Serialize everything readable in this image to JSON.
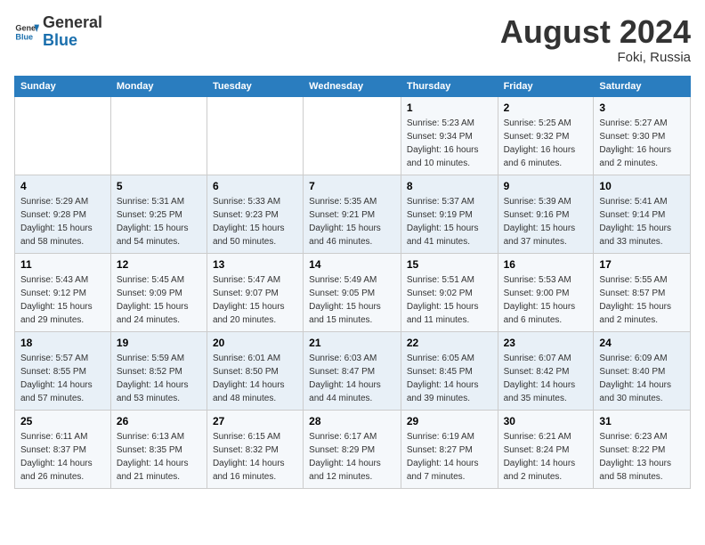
{
  "header": {
    "logo_general": "General",
    "logo_blue": "Blue",
    "month_year": "August 2024",
    "location": "Foki, Russia"
  },
  "days_of_week": [
    "Sunday",
    "Monday",
    "Tuesday",
    "Wednesday",
    "Thursday",
    "Friday",
    "Saturday"
  ],
  "weeks": [
    [
      {
        "day": "",
        "info": ""
      },
      {
        "day": "",
        "info": ""
      },
      {
        "day": "",
        "info": ""
      },
      {
        "day": "",
        "info": ""
      },
      {
        "day": "1",
        "info": "Sunrise: 5:23 AM\nSunset: 9:34 PM\nDaylight: 16 hours\nand 10 minutes."
      },
      {
        "day": "2",
        "info": "Sunrise: 5:25 AM\nSunset: 9:32 PM\nDaylight: 16 hours\nand 6 minutes."
      },
      {
        "day": "3",
        "info": "Sunrise: 5:27 AM\nSunset: 9:30 PM\nDaylight: 16 hours\nand 2 minutes."
      }
    ],
    [
      {
        "day": "4",
        "info": "Sunrise: 5:29 AM\nSunset: 9:28 PM\nDaylight: 15 hours\nand 58 minutes."
      },
      {
        "day": "5",
        "info": "Sunrise: 5:31 AM\nSunset: 9:25 PM\nDaylight: 15 hours\nand 54 minutes."
      },
      {
        "day": "6",
        "info": "Sunrise: 5:33 AM\nSunset: 9:23 PM\nDaylight: 15 hours\nand 50 minutes."
      },
      {
        "day": "7",
        "info": "Sunrise: 5:35 AM\nSunset: 9:21 PM\nDaylight: 15 hours\nand 46 minutes."
      },
      {
        "day": "8",
        "info": "Sunrise: 5:37 AM\nSunset: 9:19 PM\nDaylight: 15 hours\nand 41 minutes."
      },
      {
        "day": "9",
        "info": "Sunrise: 5:39 AM\nSunset: 9:16 PM\nDaylight: 15 hours\nand 37 minutes."
      },
      {
        "day": "10",
        "info": "Sunrise: 5:41 AM\nSunset: 9:14 PM\nDaylight: 15 hours\nand 33 minutes."
      }
    ],
    [
      {
        "day": "11",
        "info": "Sunrise: 5:43 AM\nSunset: 9:12 PM\nDaylight: 15 hours\nand 29 minutes."
      },
      {
        "day": "12",
        "info": "Sunrise: 5:45 AM\nSunset: 9:09 PM\nDaylight: 15 hours\nand 24 minutes."
      },
      {
        "day": "13",
        "info": "Sunrise: 5:47 AM\nSunset: 9:07 PM\nDaylight: 15 hours\nand 20 minutes."
      },
      {
        "day": "14",
        "info": "Sunrise: 5:49 AM\nSunset: 9:05 PM\nDaylight: 15 hours\nand 15 minutes."
      },
      {
        "day": "15",
        "info": "Sunrise: 5:51 AM\nSunset: 9:02 PM\nDaylight: 15 hours\nand 11 minutes."
      },
      {
        "day": "16",
        "info": "Sunrise: 5:53 AM\nSunset: 9:00 PM\nDaylight: 15 hours\nand 6 minutes."
      },
      {
        "day": "17",
        "info": "Sunrise: 5:55 AM\nSunset: 8:57 PM\nDaylight: 15 hours\nand 2 minutes."
      }
    ],
    [
      {
        "day": "18",
        "info": "Sunrise: 5:57 AM\nSunset: 8:55 PM\nDaylight: 14 hours\nand 57 minutes."
      },
      {
        "day": "19",
        "info": "Sunrise: 5:59 AM\nSunset: 8:52 PM\nDaylight: 14 hours\nand 53 minutes."
      },
      {
        "day": "20",
        "info": "Sunrise: 6:01 AM\nSunset: 8:50 PM\nDaylight: 14 hours\nand 48 minutes."
      },
      {
        "day": "21",
        "info": "Sunrise: 6:03 AM\nSunset: 8:47 PM\nDaylight: 14 hours\nand 44 minutes."
      },
      {
        "day": "22",
        "info": "Sunrise: 6:05 AM\nSunset: 8:45 PM\nDaylight: 14 hours\nand 39 minutes."
      },
      {
        "day": "23",
        "info": "Sunrise: 6:07 AM\nSunset: 8:42 PM\nDaylight: 14 hours\nand 35 minutes."
      },
      {
        "day": "24",
        "info": "Sunrise: 6:09 AM\nSunset: 8:40 PM\nDaylight: 14 hours\nand 30 minutes."
      }
    ],
    [
      {
        "day": "25",
        "info": "Sunrise: 6:11 AM\nSunset: 8:37 PM\nDaylight: 14 hours\nand 26 minutes."
      },
      {
        "day": "26",
        "info": "Sunrise: 6:13 AM\nSunset: 8:35 PM\nDaylight: 14 hours\nand 21 minutes."
      },
      {
        "day": "27",
        "info": "Sunrise: 6:15 AM\nSunset: 8:32 PM\nDaylight: 14 hours\nand 16 minutes."
      },
      {
        "day": "28",
        "info": "Sunrise: 6:17 AM\nSunset: 8:29 PM\nDaylight: 14 hours\nand 12 minutes."
      },
      {
        "day": "29",
        "info": "Sunrise: 6:19 AM\nSunset: 8:27 PM\nDaylight: 14 hours\nand 7 minutes."
      },
      {
        "day": "30",
        "info": "Sunrise: 6:21 AM\nSunset: 8:24 PM\nDaylight: 14 hours\nand 2 minutes."
      },
      {
        "day": "31",
        "info": "Sunrise: 6:23 AM\nSunset: 8:22 PM\nDaylight: 13 hours\nand 58 minutes."
      }
    ]
  ]
}
